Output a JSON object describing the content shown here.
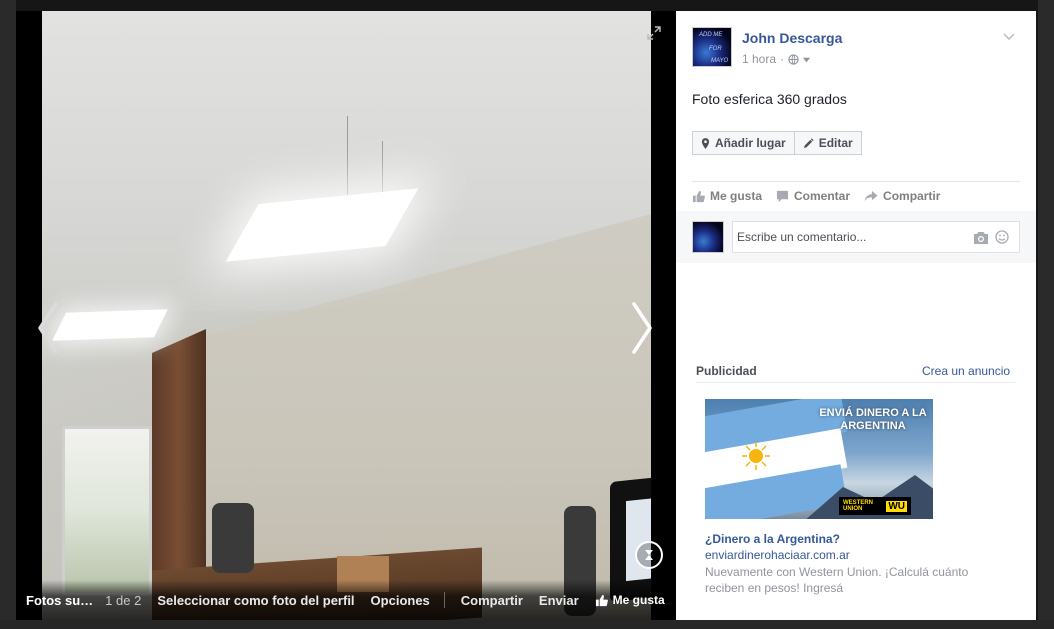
{
  "photo": {
    "album_label": "Fotos su…",
    "counter": "1 de 2",
    "actions": [
      "Seleccionar como foto del perfil",
      "Opciones"
    ],
    "share_label": "Compartir",
    "send_label": "Enviar",
    "like_label": "Me gusta"
  },
  "post": {
    "author": "John Descarga",
    "time": "1 hora",
    "dot": "·",
    "caption": "Foto esferica 360 grados",
    "add_place_label": "Añadir lugar",
    "edit_label": "Editar",
    "like_label": "Me gusta",
    "comment_label": "Comentar",
    "share_label": "Compartir",
    "comment_placeholder": "Escribe un comentario..."
  },
  "ads": {
    "title": "Publicidad",
    "create_label": "Crea un anuncio",
    "ad": {
      "image_headline": "ENVIÁ DINERO A LA ARGENTINA",
      "logo_text": "WESTERN UNION",
      "logo_mark": "WU",
      "title": "¿Dinero a la Argentina?",
      "url": "enviardinerohaciaar.com.ar",
      "description": "Nuevamente con Western Union. ¡Calculá cuánto reciben en pesos! Ingresá"
    }
  },
  "colors": {
    "link": "#365899",
    "muted": "#90949c",
    "stage": "#161616"
  }
}
